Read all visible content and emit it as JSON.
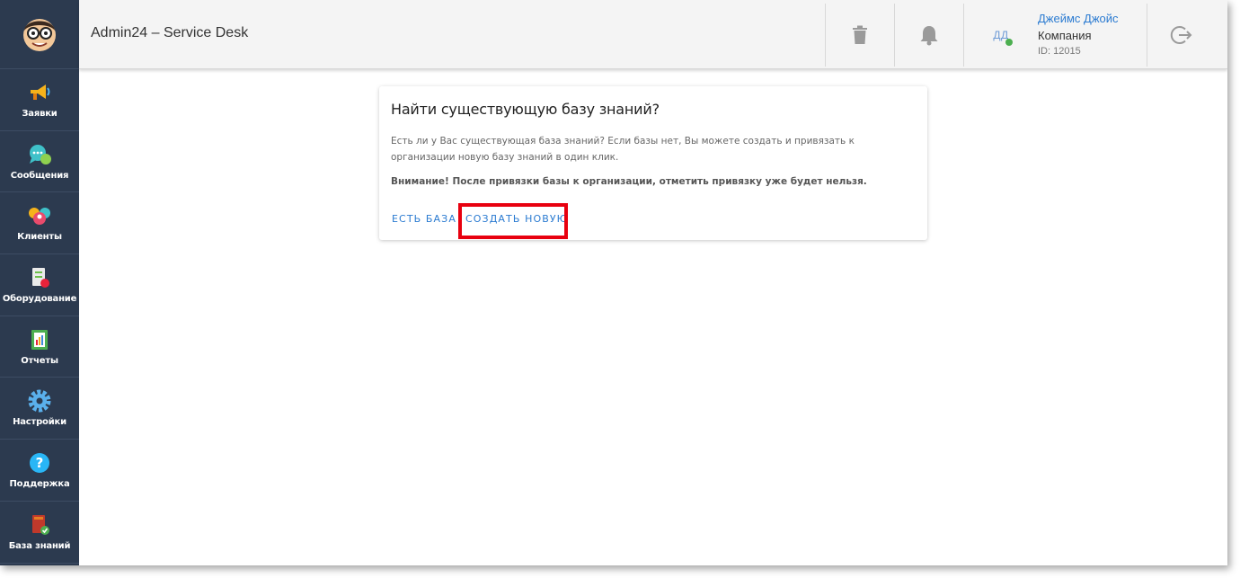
{
  "header": {
    "title": "Admin24 – Service Desk",
    "user": {
      "initials": "ДД",
      "name": "Джеймс Джойс",
      "company": "Компания",
      "id_text": "ID: 12015"
    }
  },
  "sidebar": {
    "items": [
      {
        "label": "Заявки",
        "icon": "megaphone-icon"
      },
      {
        "label": "Сообщения",
        "icon": "chat-bubble-icon"
      },
      {
        "label": "Клиенты",
        "icon": "clients-icon"
      },
      {
        "label": "Оборудование",
        "icon": "equipment-icon"
      },
      {
        "label": "Отчеты",
        "icon": "report-icon"
      },
      {
        "label": "Настройки",
        "icon": "gear-icon"
      },
      {
        "label": "Поддержка",
        "icon": "question-icon"
      },
      {
        "label": "База знаний",
        "icon": "book-icon"
      }
    ]
  },
  "dialog": {
    "title": "Найти существующую базу знаний?",
    "text": "Есть ли у Вас существующая база знаний? Если базы нет, Вы можете создать и привязать к организации новую базу знаний в один клик.",
    "warning": "Внимание! После привязки базы к организации, отметить привязку уже будет нельзя.",
    "btn_existing": "ЕСТЬ БАЗА",
    "btn_create": "СОЗДАТЬ НОВУЮ"
  },
  "colors": {
    "sidebar_bg": "#2c3a4f",
    "accent": "#2b7bd1",
    "highlight": "#e8000f",
    "online": "#4caf50"
  }
}
